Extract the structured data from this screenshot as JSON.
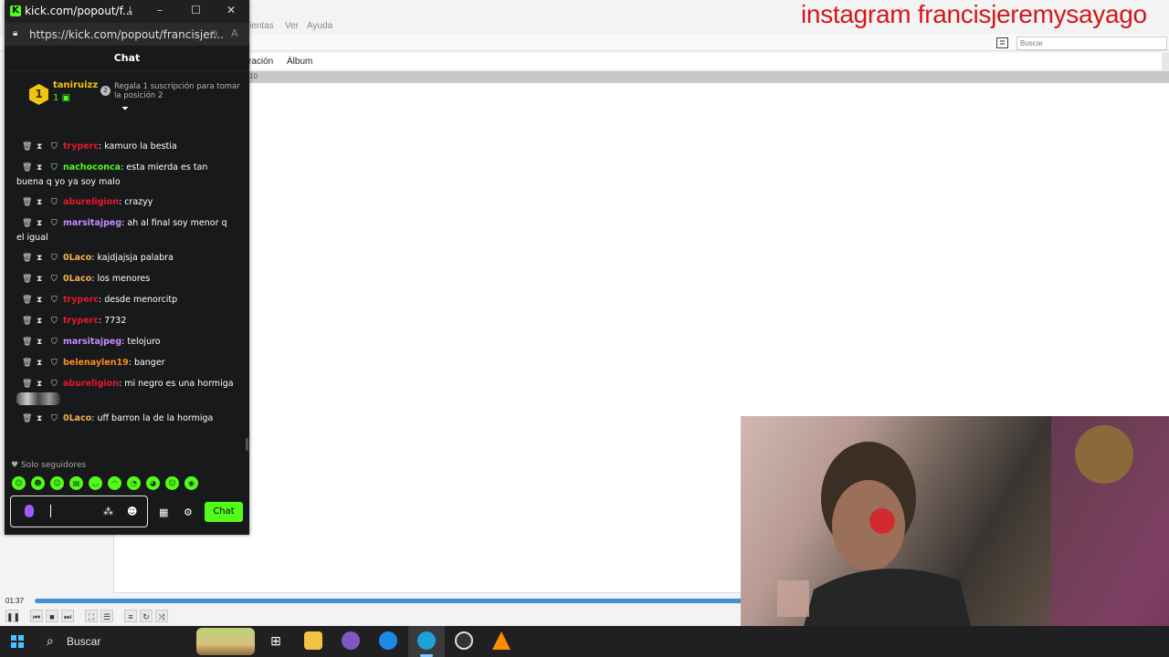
{
  "watermark": "instagram francisjeremysayago",
  "background_app": {
    "menu": [
      "ientas",
      "Ver",
      "Ayuda"
    ],
    "search_placeholder": "Buscar",
    "tabs": [
      "ración",
      "Álbum"
    ],
    "colhead_fragment": "10",
    "time": "01:37",
    "progress_fraction": 0.626
  },
  "kick": {
    "window_title": "kick.com/popout/f...",
    "url": "https://kick.com/popout/francisjer...",
    "chat_title": "Chat",
    "pinned": {
      "rank": "1",
      "user": "taniruizz",
      "count": "1",
      "gift_text": "Regala 1 suscripción para tomar la posición 2"
    },
    "messages": [
      {
        "user": "tryperc",
        "color": "#e8182e",
        "text": "kamuro la bestia"
      },
      {
        "user": "nachoconca",
        "color": "#53fc18",
        "text": "esta mierda es tan buena q yo ya soy malo"
      },
      {
        "user": "abureligion",
        "color": "#e8182e",
        "text": "crazyy"
      },
      {
        "user": "marsitajpeg",
        "color": "#c58cff",
        "text": "ah al final soy menor q el igual"
      },
      {
        "user": "0Laco",
        "color": "#f5b14c",
        "text": "kajdjajsja palabra"
      },
      {
        "user": "0Laco",
        "color": "#f5b14c",
        "text": "los menores"
      },
      {
        "user": "tryperc",
        "color": "#e8182e",
        "text": "desde menorcitp"
      },
      {
        "user": "tryperc",
        "color": "#e8182e",
        "text": "7732"
      },
      {
        "user": "marsitajpeg",
        "color": "#c58cff",
        "text": "telojuro"
      },
      {
        "user": "belenaylen19",
        "color": "#ff8a1f",
        "text": "banger"
      },
      {
        "user": "abureligion",
        "color": "#e8182e",
        "text": "mi negro es una hormiga"
      },
      {
        "user": "0Laco",
        "color": "#f5b14c",
        "text": "uff barron la de la hormiga"
      }
    ],
    "followers_only": "Solo seguidores",
    "chat_button": "Chat"
  },
  "taskbar": {
    "search": "Buscar",
    "apps": [
      "task-view-icon",
      "file-explorer-icon",
      "chrome-icon",
      "app-icon",
      "edge-icon",
      "obs-icon",
      "vlc-icon"
    ]
  }
}
